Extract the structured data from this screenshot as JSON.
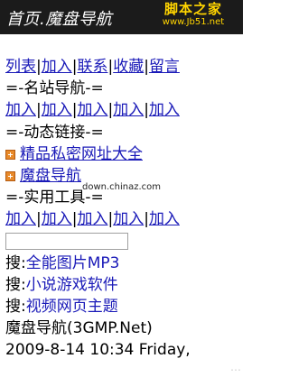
{
  "header": {
    "title": "首页.魔盘导航",
    "watermark_line1": "脚本之家",
    "watermark_line2": "www.Jb51.net"
  },
  "topnav": [
    "列表",
    "加入",
    "联系",
    "收藏",
    "留言"
  ],
  "section_sites": {
    "heading": "=-名站导航-=",
    "links": [
      "加入",
      "加入",
      "加入",
      "加入",
      "加入"
    ]
  },
  "section_dynamic": {
    "heading": "=-动态链接-=",
    "items": [
      "精品私密网址大全",
      "魔盘导航"
    ]
  },
  "watermark_mid": "down.chinaz.com",
  "section_tools": {
    "heading": "=-实用工具-=",
    "links": [
      "加入",
      "加入",
      "加入",
      "加入",
      "加入"
    ]
  },
  "search": {
    "value": "",
    "placeholder": "",
    "rows": [
      {
        "prefix": "搜:",
        "links": [
          "全能",
          "图片",
          "MP3"
        ]
      },
      {
        "prefix": "搜:",
        "links": [
          "小说",
          "游戏",
          "软件"
        ]
      },
      {
        "prefix": "搜:",
        "links": [
          "视频",
          "网页",
          "主题"
        ]
      }
    ]
  },
  "footer": {
    "site": "魔盘导航(3GMP.Net)",
    "datetime": "2009-8-14 10:34 Friday,"
  },
  "watermark_corner": "…",
  "colors": {
    "header_bg": "#1b1b1b",
    "link": "#1a1ab8",
    "bullet": "#e88a2a",
    "watermark": "#ffd400"
  }
}
